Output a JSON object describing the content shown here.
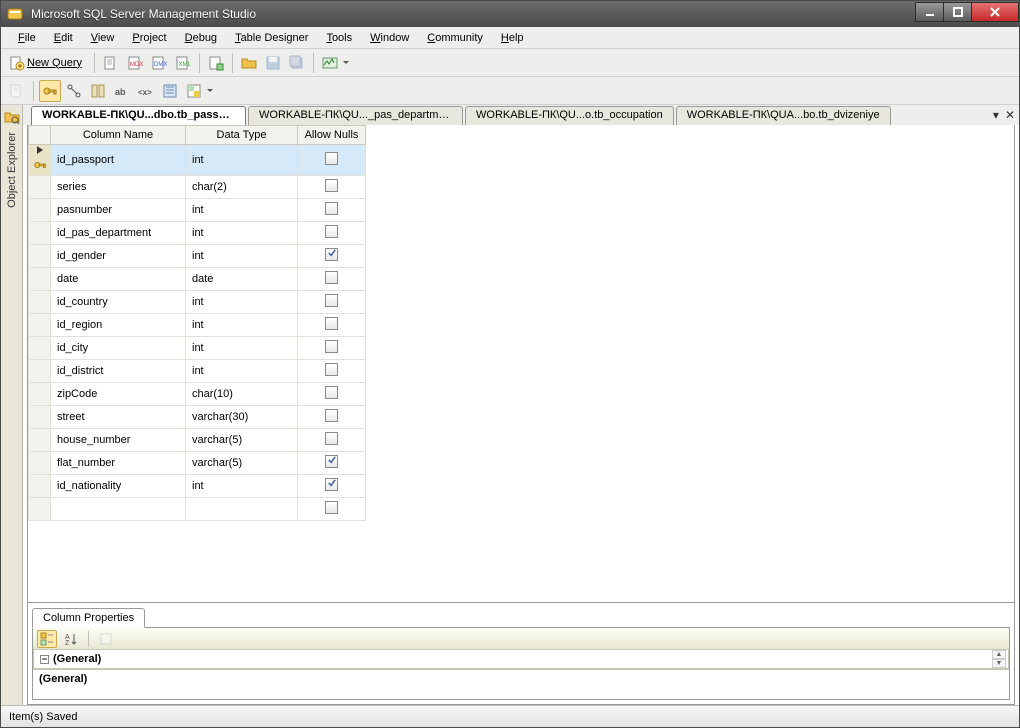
{
  "window": {
    "title": "Microsoft SQL Server Management Studio"
  },
  "menubar": [
    "File",
    "Edit",
    "View",
    "Project",
    "Debug",
    "Table Designer",
    "Tools",
    "Window",
    "Community",
    "Help"
  ],
  "toolbar1": {
    "new_query": "New Query"
  },
  "side_strip": {
    "label": "Object Explorer"
  },
  "tabs": [
    {
      "label": "WORKABLE-ПК\\QU...dbo.tb_passport",
      "active": true
    },
    {
      "label": "WORKABLE-ПК\\QU..._pas_department",
      "active": false
    },
    {
      "label": "WORKABLE-ПК\\QU...o.tb_occupation",
      "active": false
    },
    {
      "label": "WORKABLE-ПК\\QUA...bo.tb_dvizeniye",
      "active": false
    }
  ],
  "grid": {
    "headers": [
      "Column Name",
      "Data Type",
      "Allow Nulls"
    ],
    "rows": [
      {
        "key": true,
        "sel": true,
        "name": "id_passport",
        "type": "int",
        "nulls": false
      },
      {
        "key": false,
        "sel": false,
        "name": "series",
        "type": "char(2)",
        "nulls": false
      },
      {
        "key": false,
        "sel": false,
        "name": "pasnumber",
        "type": "int",
        "nulls": false
      },
      {
        "key": false,
        "sel": false,
        "name": "id_pas_department",
        "type": "int",
        "nulls": false
      },
      {
        "key": false,
        "sel": false,
        "name": "id_gender",
        "type": "int",
        "nulls": true
      },
      {
        "key": false,
        "sel": false,
        "name": "date",
        "type": "date",
        "nulls": false
      },
      {
        "key": false,
        "sel": false,
        "name": "id_country",
        "type": "int",
        "nulls": false
      },
      {
        "key": false,
        "sel": false,
        "name": "id_region",
        "type": "int",
        "nulls": false
      },
      {
        "key": false,
        "sel": false,
        "name": "id_city",
        "type": "int",
        "nulls": false
      },
      {
        "key": false,
        "sel": false,
        "name": "id_district",
        "type": "int",
        "nulls": false
      },
      {
        "key": false,
        "sel": false,
        "name": "zipCode",
        "type": "char(10)",
        "nulls": false
      },
      {
        "key": false,
        "sel": false,
        "name": "street",
        "type": "varchar(30)",
        "nulls": false
      },
      {
        "key": false,
        "sel": false,
        "name": "house_number",
        "type": "varchar(5)",
        "nulls": false
      },
      {
        "key": false,
        "sel": false,
        "name": "flat_number",
        "type": "varchar(5)",
        "nulls": true
      },
      {
        "key": false,
        "sel": false,
        "name": "id_nationality",
        "type": "int",
        "nulls": true
      },
      {
        "key": false,
        "sel": false,
        "name": "",
        "type": "",
        "nulls": false
      }
    ]
  },
  "properties": {
    "tab": "Column Properties",
    "category": "(General)",
    "description": "(General)"
  },
  "statusbar": {
    "text": "Item(s) Saved"
  }
}
